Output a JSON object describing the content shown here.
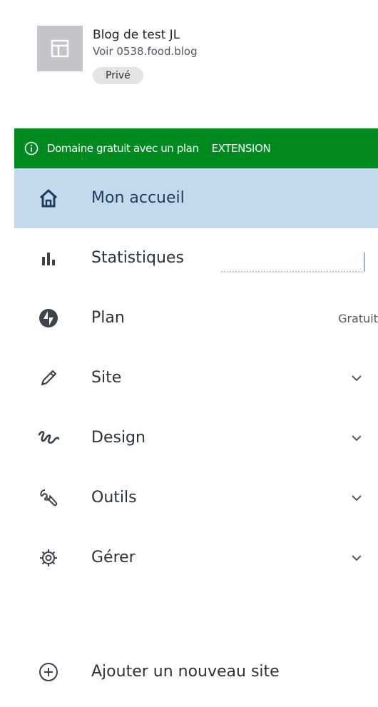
{
  "site": {
    "title": "Blog de test JL",
    "url": "Voir 0538.food.blog",
    "badge": "Privé",
    "icon": "layout-icon"
  },
  "banner": {
    "icon": "info-icon",
    "text": "Domaine gratuit avec un plan",
    "cta": "EXTENSION"
  },
  "menu": {
    "items": [
      {
        "label": "Mon accueil",
        "icon": "home-icon",
        "active": true
      },
      {
        "label": "Statistiques",
        "icon": "stats-icon"
      },
      {
        "label": "Plan",
        "icon": "jetpack-icon",
        "right": "Gratuit"
      },
      {
        "label": "Site",
        "icon": "pencil-icon",
        "expandable": true
      },
      {
        "label": "Design",
        "icon": "design-icon",
        "expandable": true
      },
      {
        "label": "Outils",
        "icon": "wrench-icon",
        "expandable": true
      },
      {
        "label": "Gérer",
        "icon": "gear-icon",
        "expandable": true
      }
    ]
  },
  "add_site": {
    "label": "Ajouter un nouveau site",
    "icon": "plus-circle-icon"
  },
  "colors": {
    "banner": "#008a20",
    "active": "#c5d9ed",
    "text": "#2c3338"
  }
}
